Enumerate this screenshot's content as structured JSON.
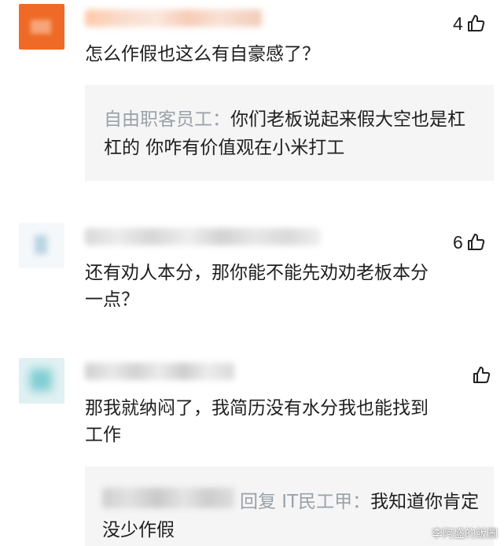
{
  "comments": [
    {
      "likes": "4",
      "text": "怎么作假也这么有自豪感了？",
      "reply": {
        "author": "自由职客员工：",
        "text": "你们老板说起来假大空也是杠杠的 你咋有价值观在小米打工"
      }
    },
    {
      "likes": "6",
      "text": "还有劝人本分，那你能不能先劝劝老板本分一点？"
    },
    {
      "likes": "",
      "text": "那我就纳闷了，我简历没有水分我也能找到工作",
      "reply": {
        "prefix": "回复 IT民工甲：",
        "text": "我知道你肯定没少作假"
      }
    }
  ],
  "watermark": "李阿盛的飯圖",
  "colors": {
    "avatar_1": "#ee6a26",
    "avatar_3": "#7fcdd2",
    "reply_bg": "#f5f5f5",
    "muted_text": "#9aa1a8"
  },
  "icons": [
    "thumbs-up-icon",
    "thumbs-up-icon",
    "thumbs-up-icon"
  ]
}
